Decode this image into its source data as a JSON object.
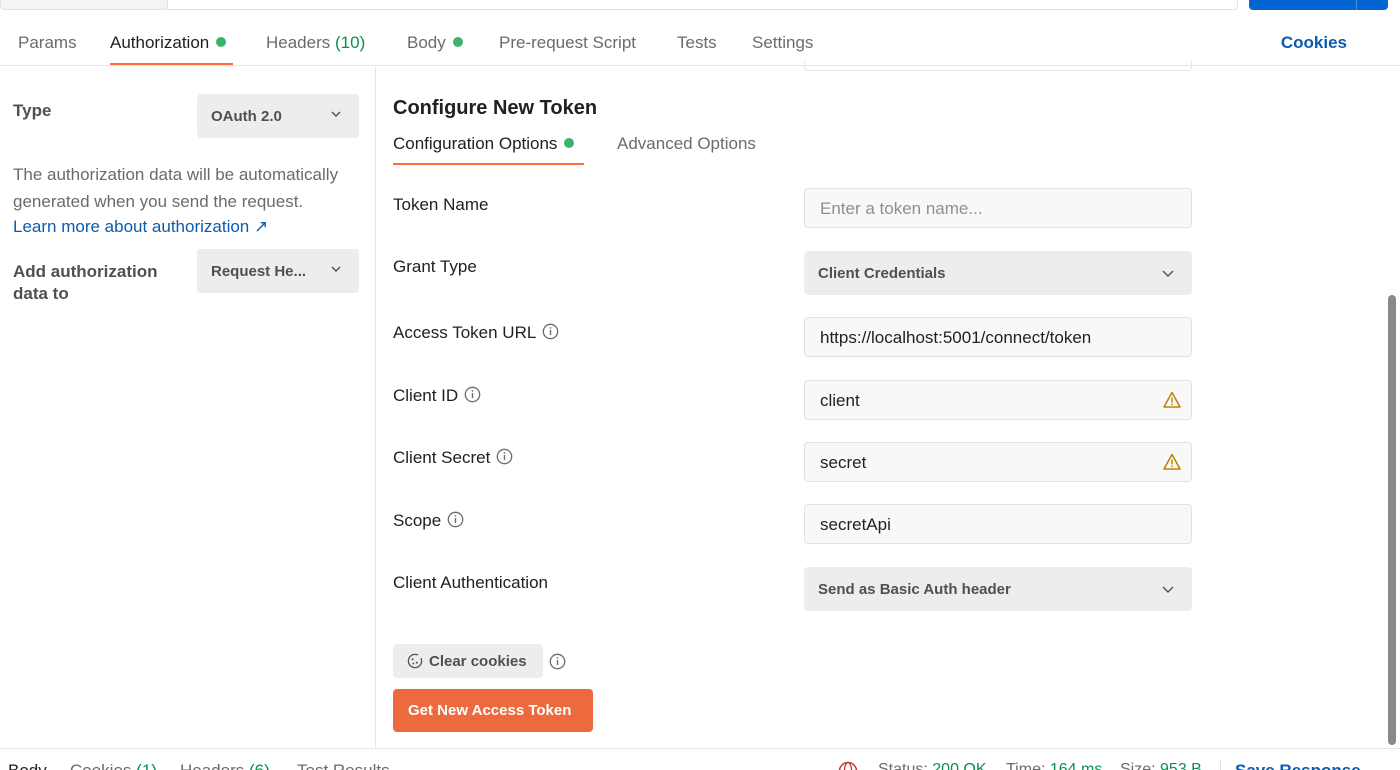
{
  "request_tabs": {
    "params": "Params",
    "authorization": "Authorization",
    "headers": "Headers",
    "headers_count": "(10)",
    "body": "Body",
    "pre_request": "Pre-request Script",
    "tests": "Tests",
    "settings": "Settings",
    "cookies": "Cookies"
  },
  "auth": {
    "type_label": "Type",
    "type_value": "OAuth 2.0",
    "description": "The authorization data will be automatically generated when you send the request.",
    "learn_more": "Learn more about authorization ↗",
    "add_to_label": "Add authorization data to",
    "add_to_value": "Request He..."
  },
  "token": {
    "section_title": "Configure New Token",
    "tabs": {
      "config": "Configuration Options",
      "advanced": "Advanced Options"
    },
    "fields": {
      "token_name_label": "Token Name",
      "token_name_placeholder": "Enter a token name...",
      "grant_type_label": "Grant Type",
      "grant_type_value": "Client Credentials",
      "access_token_url_label": "Access Token URL",
      "access_token_url_value": "https://localhost:5001/connect/token",
      "client_id_label": "Client ID",
      "client_id_value": "client",
      "client_secret_label": "Client Secret",
      "client_secret_value": "secret",
      "scope_label": "Scope",
      "scope_value": "secretApi",
      "client_auth_label": "Client Authentication",
      "client_auth_value": "Send as Basic Auth header"
    },
    "clear_cookies": "Clear cookies",
    "get_token": "Get New Access Token"
  },
  "response_bar": {
    "body": "Body",
    "cookies": "Cookies",
    "cookies_count": "(1)",
    "headers": "Headers",
    "headers_count": "(6)",
    "test_results": "Test Results",
    "status_label": "Status:",
    "status_value": "200 OK",
    "time_label": "Time:",
    "time_value": "164 ms",
    "size_label": "Size:",
    "size_value": "953 B",
    "save_response": "Save Response"
  },
  "colors": {
    "accent_orange": "#ff6c37",
    "primary_button": "#ec6a3d",
    "link_blue": "#0b5cad",
    "status_green": "#0b8f4a",
    "dot_green": "#3ab36b",
    "warning_amber": "#b98400"
  },
  "icons": {
    "info": "info-icon",
    "warning": "warning-icon",
    "chevron": "chevron-down-icon",
    "cookie": "cookie-icon",
    "globe": "globe-icon"
  }
}
